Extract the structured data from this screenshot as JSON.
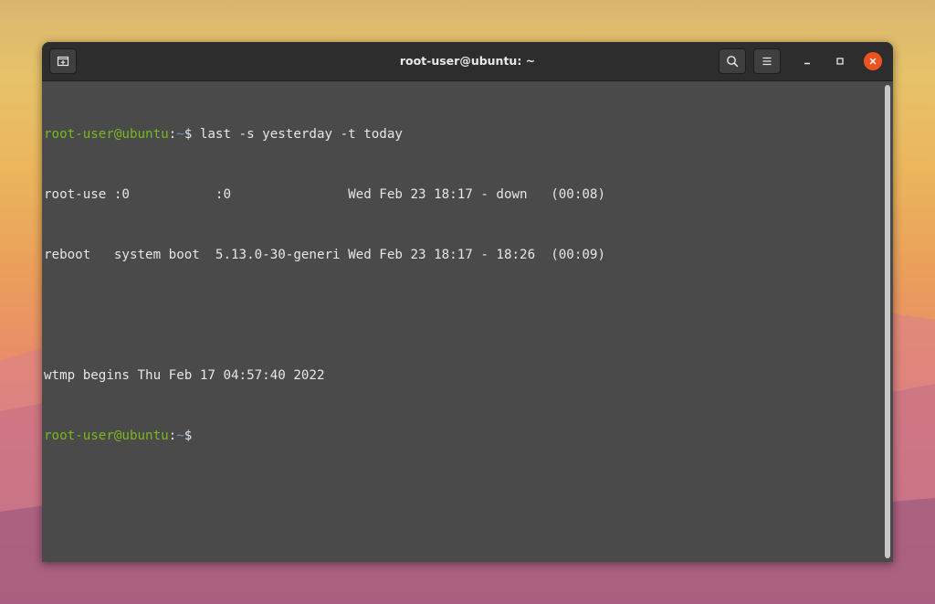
{
  "window": {
    "title": "root-user@ubuntu: ~"
  },
  "terminal": {
    "prompt": {
      "user_host": "root-user@ubuntu",
      "colon": ":",
      "path": "~",
      "symbol": "$"
    },
    "command": " last -s yesterday -t today",
    "output": [
      "root-use :0           :0               Wed Feb 23 18:17 - down   (00:08)",
      "reboot   system boot  5.13.0-30-generi Wed Feb 23 18:17 - 18:26  (00:09)",
      "",
      "wtmp begins Thu Feb 17 04:57:40 2022"
    ]
  },
  "icons": {
    "new_tab": "new-tab-icon",
    "search": "search-icon",
    "menu": "hamburger-menu-icon",
    "minimize": "minimize-icon",
    "maximize": "maximize-icon",
    "close": "close-icon"
  },
  "colors": {
    "prompt_user": "#7ab81c",
    "prompt_path": "#6c8fbf",
    "terminal_bg": "#4a4a4a",
    "titlebar_bg": "#2d2d2d",
    "close_button": "#e95420"
  }
}
